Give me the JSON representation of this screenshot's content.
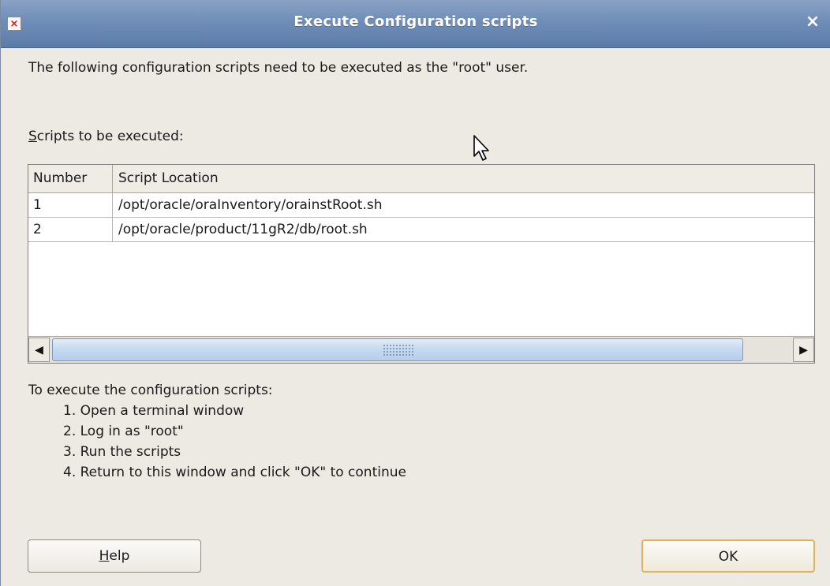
{
  "window": {
    "title": "Execute Configuration scripts",
    "close_glyph": "×",
    "menu_glyph": "×"
  },
  "intro_text": "The following configuration scripts need to be executed as the \"root\" user.",
  "scripts_label": {
    "mnemonic": "S",
    "rest": "cripts to be executed:"
  },
  "table": {
    "columns": [
      "Number",
      "Script Location"
    ],
    "rows": [
      {
        "number": "1",
        "location": "/opt/oracle/oraInventory/orainstRoot.sh"
      },
      {
        "number": "2",
        "location": "/opt/oracle/product/11gR2/db/root.sh"
      }
    ]
  },
  "scrollbar": {
    "left_arrow": "◀",
    "right_arrow": "▶"
  },
  "instructions": {
    "heading": "To execute the configuration scripts:",
    "steps": [
      "1. Open a terminal window",
      "2. Log in as \"root\"",
      "3. Run the scripts",
      "4. Return to this window and click \"OK\" to continue"
    ]
  },
  "buttons": {
    "help": {
      "mnemonic": "H",
      "rest": "elp"
    },
    "ok": "OK"
  },
  "colors": {
    "titlebar": "#6f8db7",
    "dialog_bg": "#edeae3",
    "ok_focus_border": "#e3b15a"
  },
  "icons": {
    "window_menu": "close-x-icon",
    "window_close": "close-icon",
    "cursor": "mouse-pointer-icon",
    "scroll_left": "arrow-left-icon",
    "scroll_right": "arrow-right-icon"
  }
}
